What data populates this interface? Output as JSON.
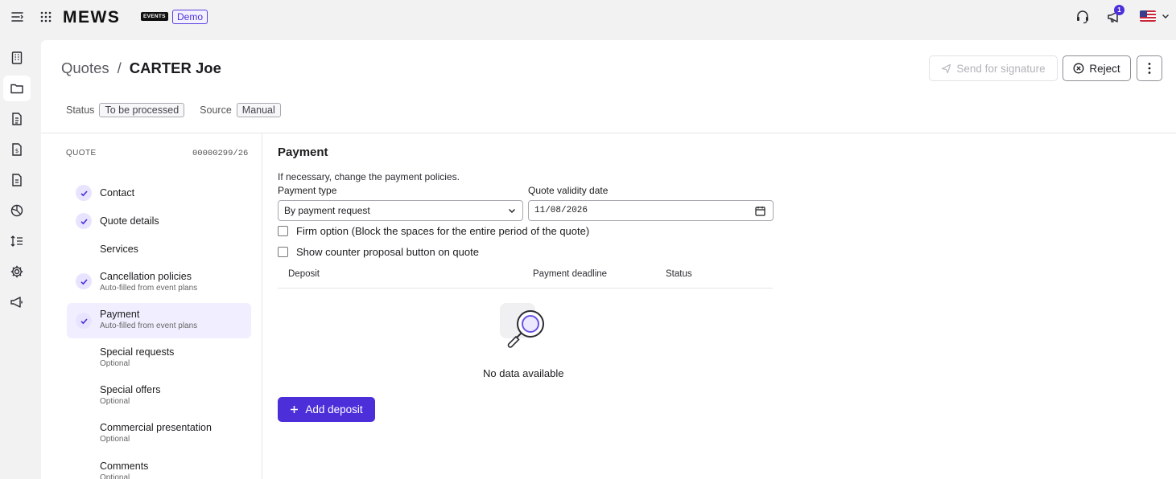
{
  "topbar": {
    "logo": "MEWS",
    "events_badge": "EVENTS",
    "demo_badge": "Demo",
    "notification_count": "1",
    "language": "en-US"
  },
  "rail": {
    "items": [
      {
        "icon": "building-icon",
        "active": false
      },
      {
        "icon": "folder-icon",
        "active": true
      },
      {
        "icon": "document-list-icon",
        "active": false
      },
      {
        "icon": "invoice-dollar-icon",
        "active": false
      },
      {
        "icon": "document-icon",
        "active": false
      },
      {
        "icon": "pie-chart-icon",
        "active": false
      },
      {
        "icon": "sort-list-icon",
        "active": false
      },
      {
        "icon": "gear-icon",
        "active": false
      },
      {
        "icon": "megaphone-icon",
        "active": false
      }
    ]
  },
  "header": {
    "breadcrumb_parent": "Quotes",
    "breadcrumb_sep": "/",
    "breadcrumb_current": "CARTER Joe",
    "status_label": "Status",
    "status_value": "To be processed",
    "source_label": "Source",
    "source_value": "Manual",
    "send_label": "Send for signature",
    "reject_label": "Reject"
  },
  "steps": {
    "quote_label": "QUOTE",
    "quote_number": "00000299/26",
    "items": [
      {
        "title": "Contact",
        "sub": "",
        "done": true
      },
      {
        "title": "Quote details",
        "sub": "",
        "done": true
      },
      {
        "title": "Services",
        "sub": "",
        "done": false
      },
      {
        "title": "Cancellation policies",
        "sub": "Auto-filled from event plans",
        "done": true
      },
      {
        "title": "Payment",
        "sub": "Auto-filled from event plans",
        "done": true
      },
      {
        "title": "Special requests",
        "sub": "Optional",
        "done": false
      },
      {
        "title": "Special offers",
        "sub": "Optional",
        "done": false
      },
      {
        "title": "Commercial presentation",
        "sub": "Optional",
        "done": false
      },
      {
        "title": "Comments",
        "sub": "Optional",
        "done": false
      }
    ]
  },
  "payment": {
    "title": "Payment",
    "description": "If necessary, change the payment policies.",
    "payment_type_label": "Payment type",
    "payment_type_value": "By payment request",
    "validity_label": "Quote validity date",
    "validity_value": "11/08/2026",
    "firm_option_label": "Firm option (Block the spaces for the entire period of the quote)",
    "counter_proposal_label": "Show counter proposal button on quote",
    "columns": [
      "Deposit",
      "Payment deadline",
      "Status"
    ],
    "empty_text": "No data available",
    "add_deposit_label": "Add deposit"
  },
  "colors": {
    "accent": "#4c2fd9",
    "active_step_bg": "#f1efff"
  }
}
